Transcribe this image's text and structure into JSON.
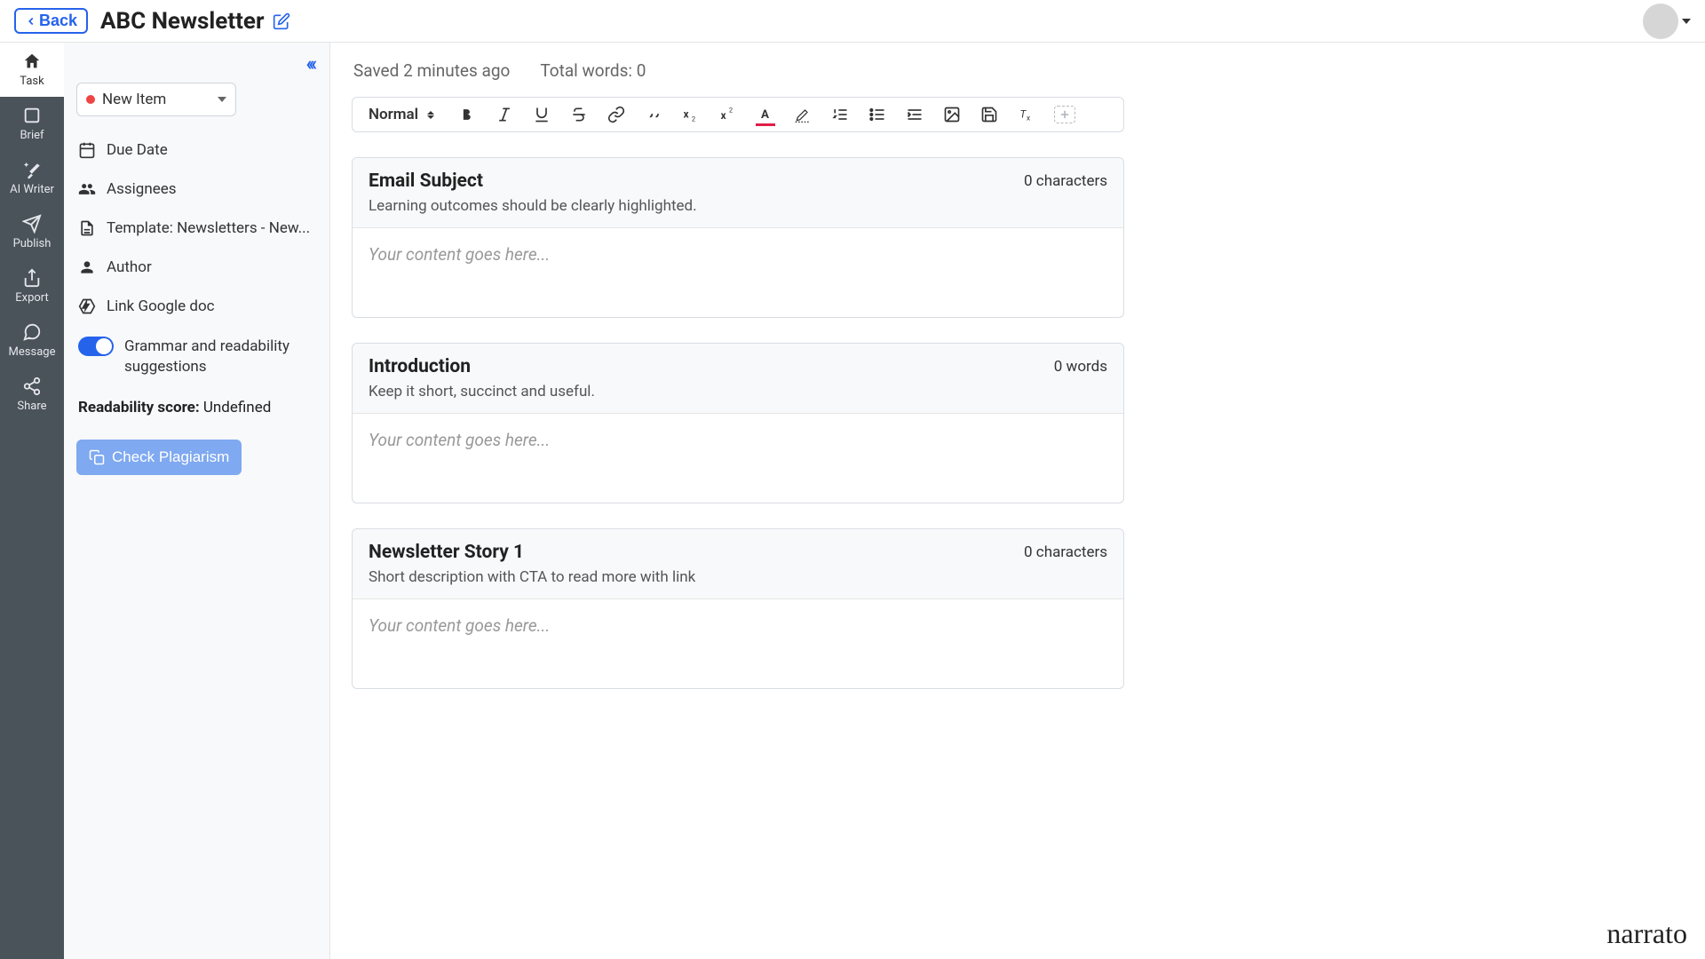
{
  "header": {
    "back": "Back",
    "title": "ABC Newsletter"
  },
  "leftnav": [
    {
      "id": "task",
      "label": "Task"
    },
    {
      "id": "brief",
      "label": "Brief"
    },
    {
      "id": "aiwriter",
      "label": "AI Writer"
    },
    {
      "id": "publish",
      "label": "Publish"
    },
    {
      "id": "export",
      "label": "Export"
    },
    {
      "id": "message",
      "label": "Message"
    },
    {
      "id": "share",
      "label": "Share"
    }
  ],
  "sidebar": {
    "status": {
      "label": "New Item",
      "color": "#ef4444"
    },
    "due_date": "Due Date",
    "assignees": "Assignees",
    "template": "Template: Newsletters - New...",
    "author": "Author",
    "link_gdoc": "Link Google doc",
    "grammar_toggle": "Grammar and readability suggestions",
    "readability_label": "Readability score:",
    "readability_value": "Undefined",
    "plagiarism_btn": "Check Plagiarism"
  },
  "editor": {
    "saved": "Saved 2 minutes ago",
    "total_words": "Total words: 0",
    "format_style": "Normal",
    "placeholder": "Your content goes here...",
    "blocks": [
      {
        "title": "Email Subject",
        "count": "0 characters",
        "sub": "Learning outcomes should be clearly highlighted."
      },
      {
        "title": "Introduction",
        "count": "0 words",
        "sub": "Keep it short, succinct and useful."
      },
      {
        "title": "Newsletter Story 1",
        "count": "0 characters",
        "sub": "Short description with CTA to read more with link"
      }
    ]
  },
  "brand": "narrato"
}
